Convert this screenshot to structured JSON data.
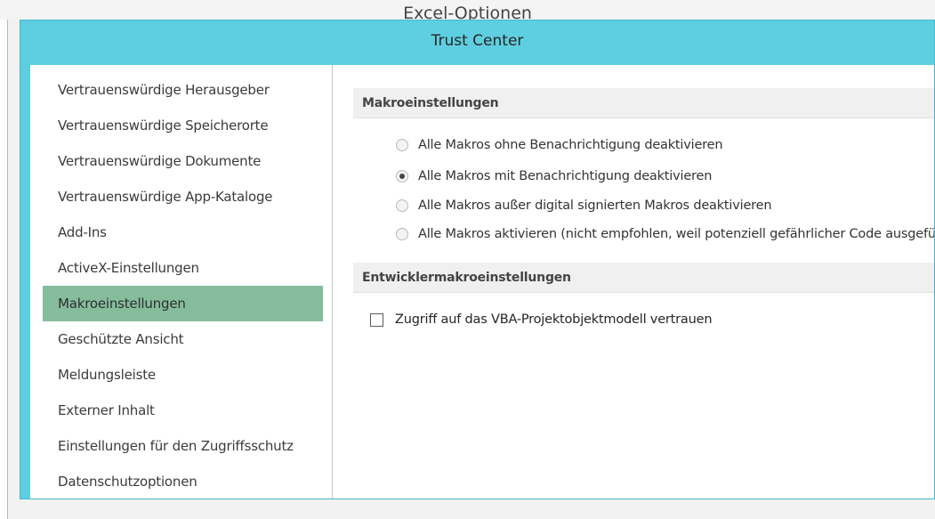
{
  "background_window": {
    "title": "Excel-Optionen"
  },
  "dialog": {
    "title": "Trust Center"
  },
  "nav": {
    "items": [
      {
        "label": "Vertrauenswürdige Herausgeber",
        "selected": false
      },
      {
        "label": "Vertrauenswürdige Speicherorte",
        "selected": false
      },
      {
        "label": "Vertrauenswürdige Dokumente",
        "selected": false
      },
      {
        "label": "Vertrauenswürdige App-Kataloge",
        "selected": false
      },
      {
        "label": "Add-Ins",
        "selected": false
      },
      {
        "label": "ActiveX-Einstellungen",
        "selected": false
      },
      {
        "label": "Makroeinstellungen",
        "selected": true
      },
      {
        "label": "Geschützte Ansicht",
        "selected": false
      },
      {
        "label": "Meldungsleiste",
        "selected": false
      },
      {
        "label": "Externer Inhalt",
        "selected": false
      },
      {
        "label": "Einstellungen für den Zugriffsschutz",
        "selected": false
      },
      {
        "label": "Datenschutzoptionen",
        "selected": false
      }
    ]
  },
  "macro_settings": {
    "header": "Makroeinstellungen",
    "options": [
      {
        "label": "Alle Makros ohne Benachrichtigung deaktivieren",
        "checked": false
      },
      {
        "label": "Alle Makros mit Benachrichtigung deaktivieren",
        "checked": true
      },
      {
        "label": "Alle Makros außer digital signierten Makros deaktivieren",
        "checked": false
      },
      {
        "label": "Alle Makros aktivieren (nicht empfohlen, weil potenziell gefährlicher Code ausgeführt werden kann)",
        "checked": false
      }
    ]
  },
  "developer_settings": {
    "header": "Entwicklermakroeinstellungen",
    "vba_trust": {
      "label": "Zugriff auf das VBA-Projektobjektmodell vertrauen",
      "checked": false
    }
  },
  "colors": {
    "titlebar": "#5ecfe0",
    "selected_nav": "#85bd9c",
    "section_header_bg": "#f0f0f0"
  }
}
